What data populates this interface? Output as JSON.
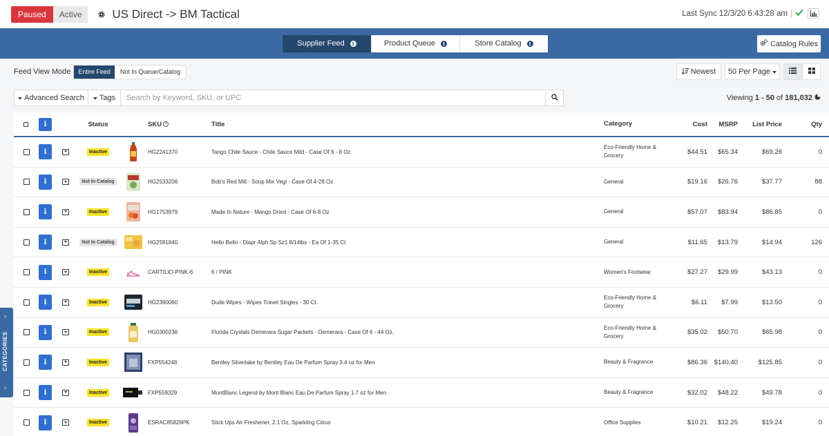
{
  "header": {
    "paused_label": "Paused",
    "active_label": "Active",
    "title": "US Direct -> BM Tactical",
    "last_sync": "Last Sync 12/3/20 6:43:28 am",
    "sync_separator": "|"
  },
  "tabs": [
    {
      "label": "Supplier Feed",
      "selected": true
    },
    {
      "label": "Product Queue",
      "selected": false
    },
    {
      "label": "Store Catalog",
      "selected": false
    }
  ],
  "catalog_rules_label": "Catalog Rules",
  "mode": {
    "label": "Feed View Mode",
    "options": [
      "Entire Feed",
      "Not In Queue/Catalog"
    ],
    "selected": "Entire Feed"
  },
  "sort_label": "Newest",
  "per_page_label": "50 Per Page",
  "search": {
    "advanced_label": "Advanced Search",
    "tags_label": "Tags",
    "placeholder": "Search by Keyword, SKU, or UPC"
  },
  "viewing": {
    "prefix": "Viewing",
    "range": "1 - 50",
    "of": "of",
    "total": "181,032"
  },
  "columns": {
    "status": "Status",
    "sku": "SKU",
    "title": "Title",
    "category": "Category",
    "cost": "Cost",
    "msrp": "MSRP",
    "list_price": "List Price",
    "qty": "Qty"
  },
  "rows": [
    {
      "status": "Inactive",
      "sku": "HG2241370",
      "title": "Tango Chile Sauce - Chile Sauce Mild - Case Of 6 - 8 Oz",
      "category": "Eco-Friendly Home & Grocery",
      "cost": "$44.51",
      "msrp": "$65.34",
      "list_price": "$69.26",
      "qty": "0"
    },
    {
      "status": "Not In Catalog",
      "sku": "HG2533206",
      "title": "Bob's Red Mill - Soup Mix Vegi - Case Of 4-28 Oz",
      "category": "General",
      "cost": "$19.16",
      "msrp": "$26.76",
      "list_price": "$37.77",
      "qty": "88"
    },
    {
      "status": "Inactive",
      "sku": "HG1753979",
      "title": "Made In Nature - Mango Dried - Case Of 6-8 Oz",
      "category": "General",
      "cost": "$57.07",
      "msrp": "$83.94",
      "list_price": "$86.85",
      "qty": "0"
    },
    {
      "status": "Not In Catalog",
      "sku": "HG2591840",
      "title": "Hello Bello - Diapr Alph Sp Sz1 8/14lbs - Ea Of 1-35 Ct",
      "category": "General",
      "cost": "$11.65",
      "msrp": "$13.79",
      "list_price": "$14.94",
      "qty": "126"
    },
    {
      "status": "Inactive",
      "sku": "CARTILIO-PINK-6",
      "title": "6 / PINK",
      "category": "Women's Footwear",
      "cost": "$27.27",
      "msrp": "$29.99",
      "list_price": "$43.13",
      "qty": "0"
    },
    {
      "status": "Inactive",
      "sku": "HG2390060",
      "title": "Dude Wipes - Wipes Travel Singles - 30 Ct.",
      "category": "Eco-Friendly Home & Grocery",
      "cost": "$6.11",
      "msrp": "$7.99",
      "list_price": "$13.50",
      "qty": "0"
    },
    {
      "status": "Inactive",
      "sku": "HG0300236",
      "title": "Florida Crystals Demerara Sugar Packets - Demerara - Case Of 6 - 44 Oz.",
      "category": "Eco-Friendly Home & Grocery",
      "cost": "$35.02",
      "msrp": "$50.70",
      "list_price": "$65.98",
      "qty": "0"
    },
    {
      "status": "Inactive",
      "sku": "FXP554248",
      "title": "Bentley Silverlake by Bentley Eau De Parfum Spray 3.4 oz for Men",
      "category": "Beauty & Fragrance",
      "cost": "$86.36",
      "msrp": "$140.40",
      "list_price": "$125.85",
      "qty": "0"
    },
    {
      "status": "Inactive",
      "sku": "FXP559329",
      "title": "MontBlanc Legend by Mont Blanc Eau De Parfum Spray 1.7 oz for Men",
      "category": "Beauty & Fragrance",
      "cost": "$32.02",
      "msrp": "$48.22",
      "list_price": "$49.78",
      "qty": "0"
    },
    {
      "status": "Inactive",
      "sku": "ESRAC85826PK",
      "title": "Stick Ups Air Freshener, 2.1 Oz, Sparkling Citrus",
      "category": "Office Supplies",
      "cost": "$10.21",
      "msrp": "$12.25",
      "list_price": "$19.24",
      "qty": "0"
    }
  ],
  "sidebar": {
    "label": "CATEGORIES"
  },
  "colors": {
    "brand_blue": "#3a6aa3",
    "navy": "#25476e",
    "paused_red": "#d9363e",
    "inactive_yellow": "#f5e227",
    "info_blue": "#2f6fd1",
    "sync_green": "#2eae4e"
  },
  "icons": [
    "gear-icon",
    "check-icon",
    "chart-icon",
    "info-icon",
    "cogs-icon",
    "sort-icon",
    "caret-down-icon",
    "list-view-icon",
    "grid-view-icon",
    "search-icon",
    "pie-icon",
    "help-icon",
    "chevron-right-icon"
  ]
}
